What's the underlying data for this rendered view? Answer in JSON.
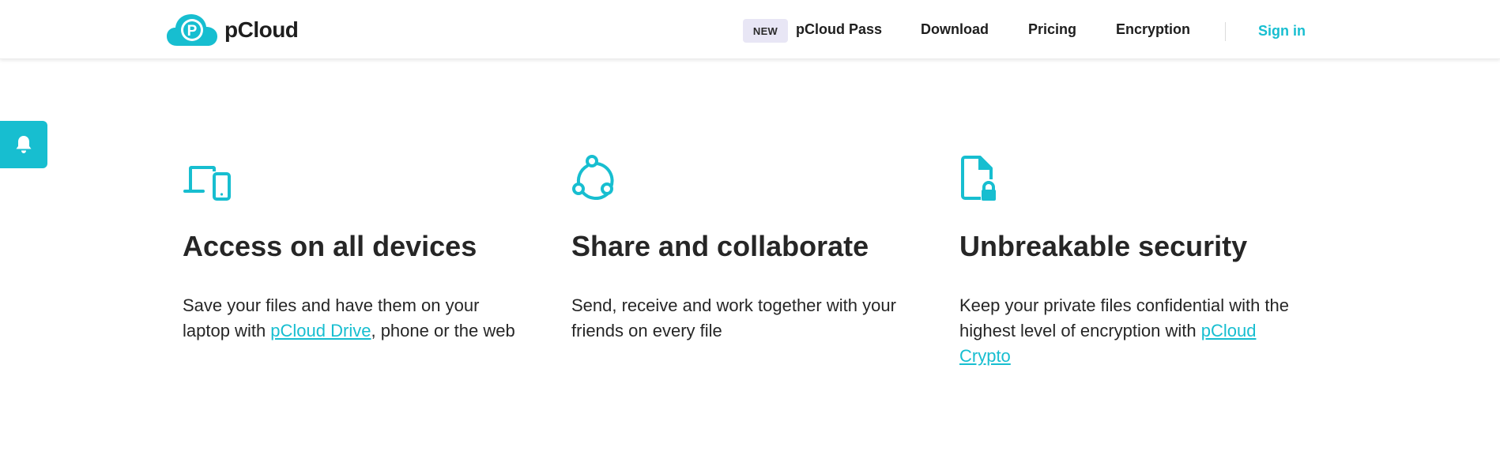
{
  "header": {
    "logo_text": "pCloud",
    "nav": {
      "badge": "NEW",
      "pass_label": "pCloud Pass",
      "download_label": "Download",
      "pricing_label": "Pricing",
      "encryption_label": "Encryption",
      "signin_label": "Sign in"
    }
  },
  "colors": {
    "accent": "#17bed0",
    "text": "#262626",
    "badge_bg": "#e8e6f5"
  },
  "notification_tab": {
    "icon": "bell-icon"
  },
  "features": [
    {
      "icon": "devices-icon",
      "title": "Access on all devices",
      "desc_before": "Save your files and have them on your laptop with ",
      "link": "pCloud Drive",
      "desc_after": ", phone or the web"
    },
    {
      "icon": "share-icon",
      "title": "Share and collaborate",
      "desc": "Send, receive and work together with your friends on every file"
    },
    {
      "icon": "secure-file-icon",
      "title": "Unbreakable security",
      "desc_before": "Keep your private files confidential with the highest level of encryption with ",
      "link": "pCloud Crypto"
    }
  ]
}
